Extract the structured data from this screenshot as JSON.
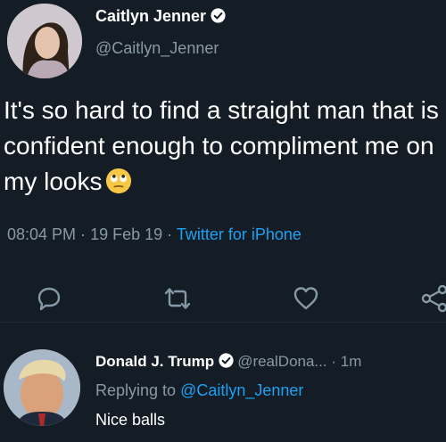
{
  "tweet": {
    "author_name": "Caitlyn Jenner",
    "author_handle": "@Caitlyn_Jenner",
    "text": "It's so hard to find a straight man that is confident enough to compliment me on my looks",
    "emoji_icon": "rolling-eyes-emoji",
    "time": "08:04 PM",
    "date": "19 Feb 19",
    "separator": "·",
    "source": "Twitter for iPhone"
  },
  "actions": [
    {
      "name": "reply",
      "icon": "comment-icon"
    },
    {
      "name": "retweet",
      "icon": "retweet-icon"
    },
    {
      "name": "like",
      "icon": "heart-icon"
    },
    {
      "name": "share",
      "icon": "share-icon"
    }
  ],
  "reply": {
    "author_name": "Donald J. Trump",
    "author_handle": "@realDona...",
    "separator": "·",
    "time": "1m",
    "replying_prefix": "Replying to ",
    "replying_to": "@Caitlyn_Jenner",
    "text": "Nice balls"
  },
  "colors": {
    "background": "#141d26",
    "text": "#ffffff",
    "muted": "#8899a6",
    "accent": "#1da1f2"
  }
}
